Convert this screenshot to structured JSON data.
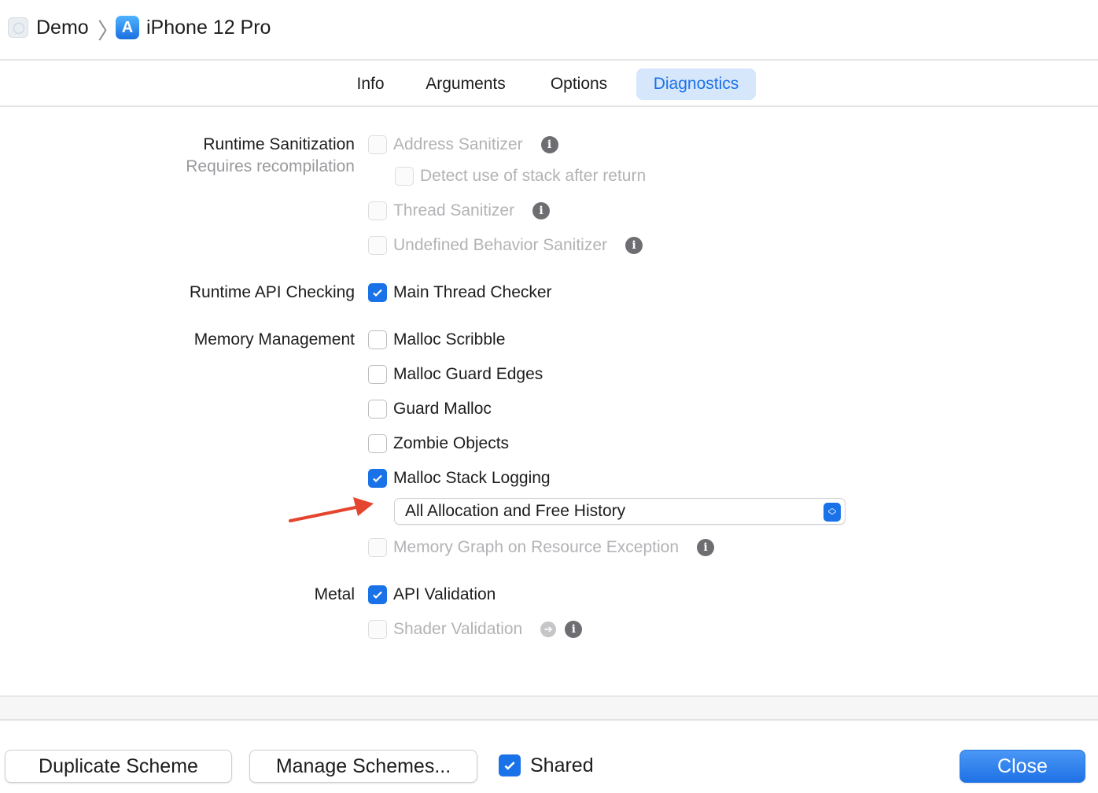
{
  "breadcrumb": {
    "scheme": "Demo",
    "destination": "iPhone 12 Pro"
  },
  "tabs": [
    {
      "label": "Info",
      "active": false
    },
    {
      "label": "Arguments",
      "active": false
    },
    {
      "label": "Options",
      "active": false
    },
    {
      "label": "Diagnostics",
      "active": true
    }
  ],
  "sections": {
    "runtime_sanitization": {
      "label": "Runtime Sanitization",
      "sublabel": "Requires recompilation",
      "address_sanitizer": {
        "label": "Address Sanitizer",
        "checked": false,
        "enabled": false
      },
      "detect_stack": {
        "label": "Detect use of stack after return",
        "checked": false,
        "enabled": false
      },
      "thread_sanitizer": {
        "label": "Thread Sanitizer",
        "checked": false,
        "enabled": false
      },
      "ub_sanitizer": {
        "label": "Undefined Behavior Sanitizer",
        "checked": false,
        "enabled": false
      }
    },
    "runtime_api": {
      "label": "Runtime API Checking",
      "main_thread_checker": {
        "label": "Main Thread Checker",
        "checked": true
      }
    },
    "memory": {
      "label": "Memory Management",
      "malloc_scribble": {
        "label": "Malloc Scribble",
        "checked": false
      },
      "malloc_guard_edges": {
        "label": "Malloc Guard Edges",
        "checked": false
      },
      "guard_malloc": {
        "label": "Guard Malloc",
        "checked": false
      },
      "zombie_objects": {
        "label": "Zombie Objects",
        "checked": false
      },
      "malloc_stack_logging": {
        "label": "Malloc Stack Logging",
        "checked": true
      },
      "stack_logging_mode": {
        "value": "All Allocation and Free History"
      },
      "memory_graph": {
        "label": "Memory Graph on Resource Exception",
        "checked": false,
        "enabled": false
      }
    },
    "metal": {
      "label": "Metal",
      "api_validation": {
        "label": "API Validation",
        "checked": true
      },
      "shader_validation": {
        "label": "Shader Validation",
        "checked": false,
        "enabled": false
      }
    }
  },
  "footer": {
    "duplicate_label": "Duplicate Scheme",
    "manage_label": "Manage Schemes...",
    "shared_label": "Shared",
    "shared_checked": true,
    "close_label": "Close"
  },
  "colors": {
    "accent": "#1a72e8",
    "arrow": "#e5442f",
    "disabled_text": "#b3b3b6"
  }
}
